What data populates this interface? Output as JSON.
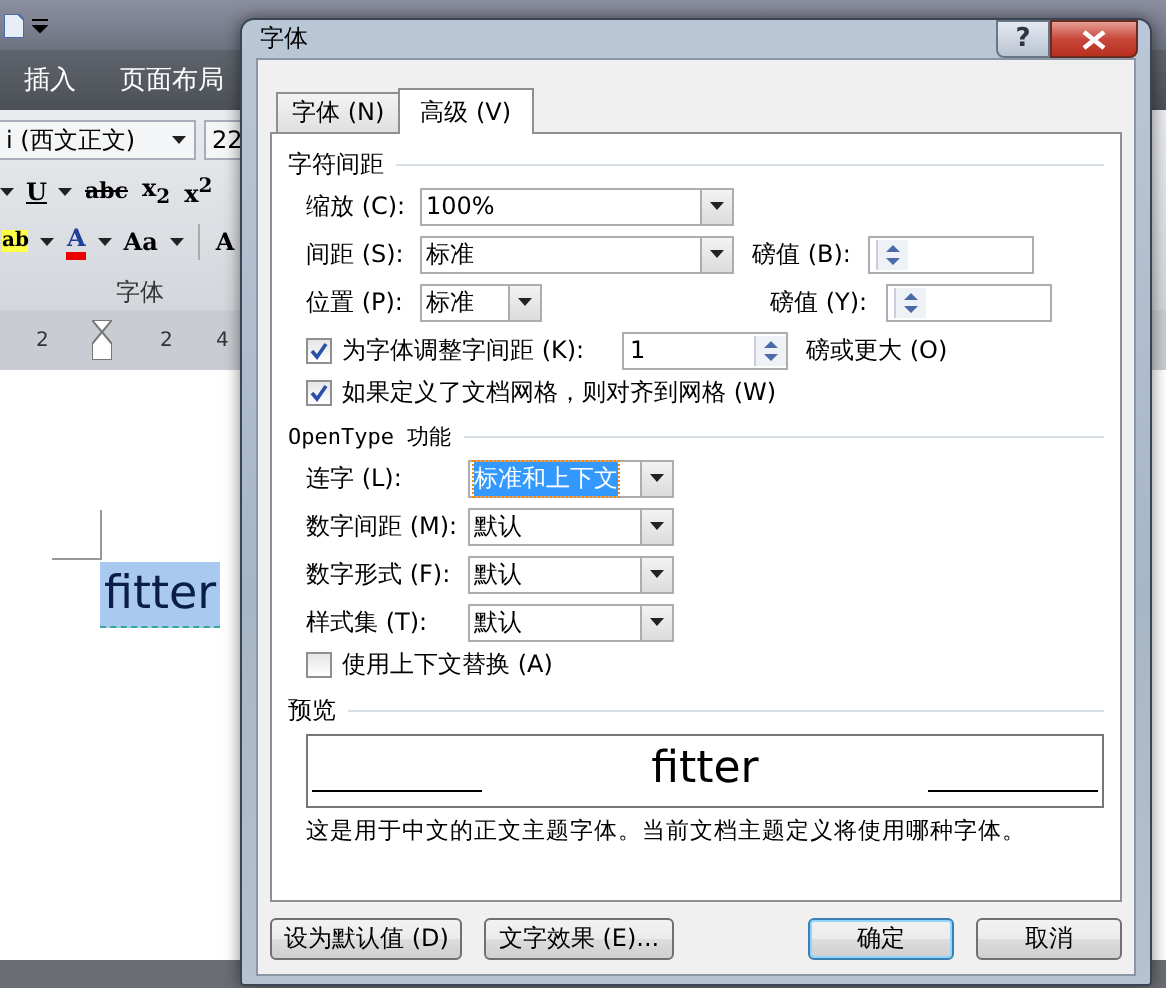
{
  "word": {
    "ribbon_tabs": [
      {
        "label": "插入",
        "selected": false
      },
      {
        "label": "页面布局",
        "selected": false
      }
    ],
    "font_name": "i (西文正文)",
    "font_size": "22",
    "format_row_1": [
      {
        "label": "U",
        "kind": "underline"
      },
      {
        "label": "abc",
        "kind": "strike"
      },
      {
        "label": "x$_{2}$",
        "kind": "plain"
      },
      {
        "label": "x$^{2}$",
        "kind": "plain"
      }
    ],
    "format_row_2": [
      {
        "label": "ab",
        "kind": "highlight"
      },
      {
        "label": "A",
        "kind": "font_color"
      },
      {
        "label": "Aa",
        "kind": "case"
      },
      {
        "label": "A",
        "kind": "plain"
      }
    ],
    "group_label": "字体",
    "ruler_labels": [
      "2",
      "2",
      "4"
    ],
    "document": {
      "text": "fitter",
      "selected": true
    }
  },
  "dialog": {
    "title": "字体",
    "help_button": "?",
    "tabs": [
      {
        "label": "字体 (N)",
        "selected": false
      },
      {
        "label": "高级 (V)",
        "selected": true
      }
    ],
    "spacing_section": {
      "title": "字符间距",
      "scale": {
        "label": "缩放 (C):",
        "value": "100%"
      },
      "spacing": {
        "label": "间距 (S):",
        "value": "标准",
        "points_label": "磅值 (B):"
      },
      "position": {
        "label": "位置 (P):",
        "value": "标准",
        "points_label": "磅值 (Y):"
      },
      "kerning": {
        "label": "为字体调整字间距 (K):",
        "checked": true,
        "value": "1",
        "suffix": "磅或更大 (O)"
      },
      "snap_to_grid": {
        "label": "如果定义了文档网格，则对齐到网格 (W)",
        "checked": true
      }
    },
    "opentype_section": {
      "title": "OpenType 功能",
      "combos": [
        {
          "label": "连字 (L):",
          "value": "标准和上下文",
          "selected": true
        },
        {
          "label": "数字间距 (M):",
          "value": "默认",
          "selected": false
        },
        {
          "label": "数字形式 (F):",
          "value": "默认",
          "selected": false
        },
        {
          "label": "样式集 (T):",
          "value": "默认",
          "selected": false
        }
      ],
      "contextual_alternates": {
        "label": "使用上下文替换 (A)",
        "checked": false
      }
    },
    "preview_section": {
      "title": "预览",
      "sample": "fitter",
      "description": "这是用于中文的正文主题字体。当前文档主题定义将使用哪种字体。"
    },
    "buttons": [
      {
        "label": "设为默认值 (D)",
        "default": false
      },
      {
        "label": "文字效果 (E)...",
        "default": false
      },
      {
        "label": "确定",
        "default": true
      },
      {
        "label": "取消",
        "default": false
      }
    ]
  }
}
